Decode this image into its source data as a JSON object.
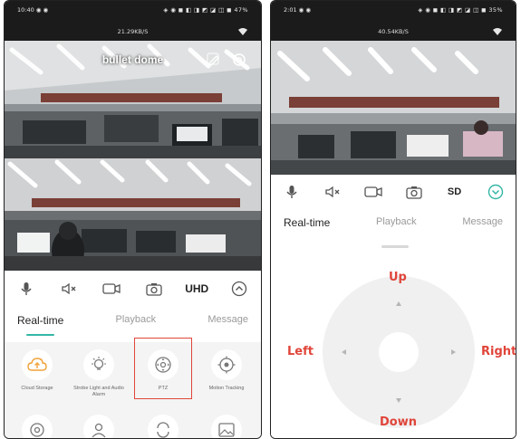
{
  "left_phone": {
    "status_time": "10:40 ◉ ◉",
    "status_icons": "◈ ◉ ◼ ◧ ◨ ◩ ◪ ◫ ◼ 47%",
    "net_speed": "21.29KB/S",
    "camera_title": "bullet dome",
    "toolbar": {
      "quality_label": "UHD"
    },
    "tabs": {
      "realtime": "Real-time",
      "playback": "Playback",
      "message": "Message"
    },
    "features": [
      {
        "label": "Cloud Storage"
      },
      {
        "label": "Strobe Light and Audio Alarm"
      },
      {
        "label": "PTZ"
      },
      {
        "label": "Motion Tracking"
      }
    ]
  },
  "right_phone": {
    "status_time": "2:01 ◉ ◉",
    "status_icons": "◈ ◉ ◼ ◧ ◨ ◩ ◪ ◫ ◼ 35%",
    "net_speed": "40.54KB/S",
    "toolbar": {
      "quality_label": "SD"
    },
    "tabs": {
      "realtime": "Real-time",
      "playback": "Playback",
      "message": "Message"
    },
    "ptz": {
      "up": "Up",
      "down": "Down",
      "left": "Left",
      "right": "Right"
    }
  },
  "colors": {
    "accent": "#34b6a6",
    "annotation": "#e0453a"
  }
}
